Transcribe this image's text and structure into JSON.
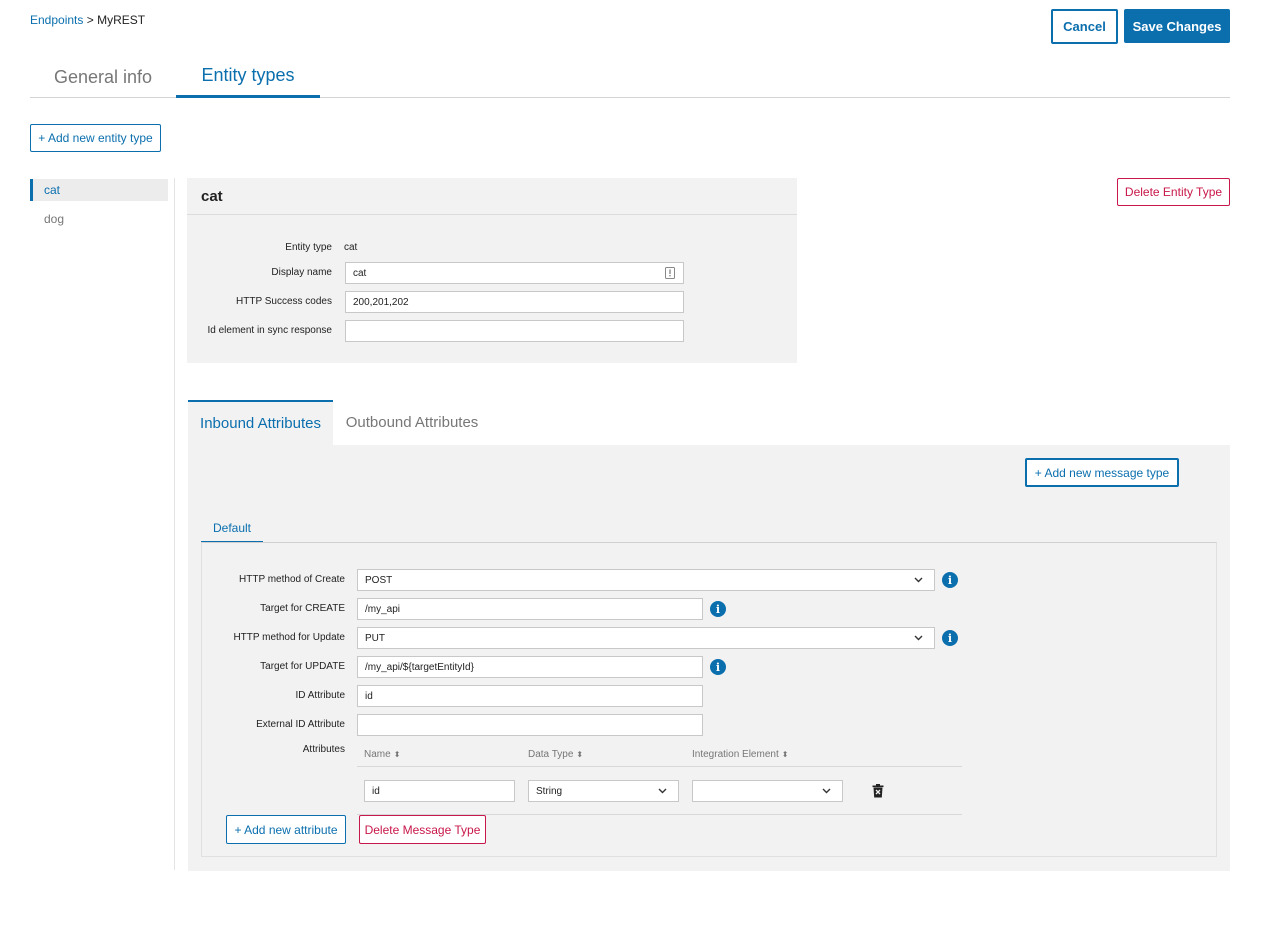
{
  "breadcrumb": {
    "link": "Endpoints",
    "separator": ">",
    "current": "MyREST"
  },
  "header": {
    "cancel_label": "Cancel",
    "save_label": "Save Changes"
  },
  "main_tabs": [
    {
      "label": "General info",
      "active": false
    },
    {
      "label": "Entity types",
      "active": true
    }
  ],
  "add_entity_label": "+ Add new entity type",
  "entity_list": [
    {
      "label": "cat",
      "active": true
    },
    {
      "label": "dog",
      "active": false
    }
  ],
  "entity": {
    "heading": "cat",
    "delete_label": "Delete Entity Type",
    "fields": {
      "entity_type_label": "Entity type",
      "entity_type_value": "cat",
      "display_name_label": "Display name",
      "display_name_value": "cat",
      "success_codes_label": "HTTP Success codes",
      "success_codes_value": "200,201,202",
      "id_element_label": "Id element in sync response",
      "id_element_value": ""
    }
  },
  "attr_tabs": [
    {
      "label": "Inbound Attributes",
      "active": true
    },
    {
      "label": "Outbound Attributes",
      "active": false
    }
  ],
  "add_message_label": "+ Add new message type",
  "message_tab": "Default",
  "message": {
    "create_method_label": "HTTP method of Create",
    "create_method_value": "POST",
    "create_target_label": "Target for CREATE",
    "create_target_value": "/my_api",
    "update_method_label": "HTTP method for Update",
    "update_method_value": "PUT",
    "update_target_label": "Target for UPDATE",
    "update_target_value": "/my_api/${targetEntityId}",
    "id_attr_label": "ID Attribute",
    "id_attr_value": "id",
    "ext_id_label": "External ID Attribute",
    "ext_id_value": "",
    "attributes_label": "Attributes"
  },
  "attributes_table": {
    "headers": [
      "Name",
      "Data Type",
      "Integration Element"
    ],
    "rows": [
      {
        "name": "id",
        "data_type": "String",
        "integration_element": ""
      }
    ]
  },
  "add_attribute_label": "+ Add new attribute",
  "delete_message_label": "Delete Message Type",
  "colors": {
    "accent": "#0b6fae",
    "danger": "#c8174a",
    "panel": "#f2f2f2"
  },
  "icons": [
    "info-icon",
    "chevron-down-icon",
    "sort-icon",
    "trash-icon",
    "text-field-icon"
  ]
}
